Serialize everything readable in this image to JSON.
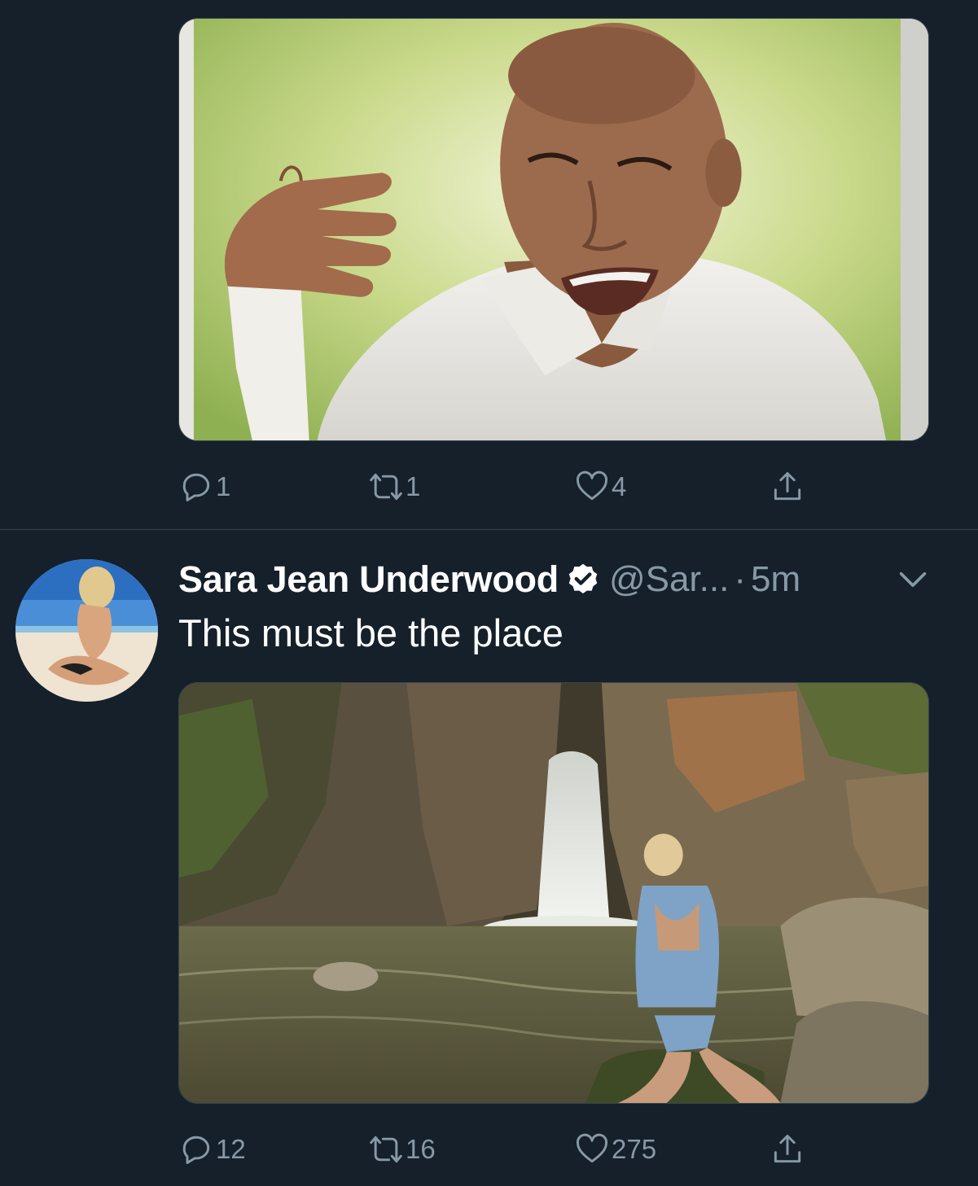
{
  "tweet1": {
    "actions": {
      "reply_count": "1",
      "retweet_count": "1",
      "like_count": "4"
    }
  },
  "tweet2": {
    "display_name": "Sara Jean Underwood",
    "handle": "@Sar...",
    "separator": "·",
    "time": "5m",
    "text": "This must be the place",
    "actions": {
      "reply_count": "12",
      "retweet_count": "16",
      "like_count": "275"
    }
  },
  "icons": {
    "reply": "reply-icon",
    "retweet": "retweet-icon",
    "like": "heart-icon",
    "share": "share-icon",
    "verified": "verified-badge-icon",
    "caret": "chevron-down-icon"
  },
  "colors": {
    "background": "#15202b",
    "muted_text": "#8899a6",
    "divider": "#38444d",
    "text": "#ffffff"
  }
}
